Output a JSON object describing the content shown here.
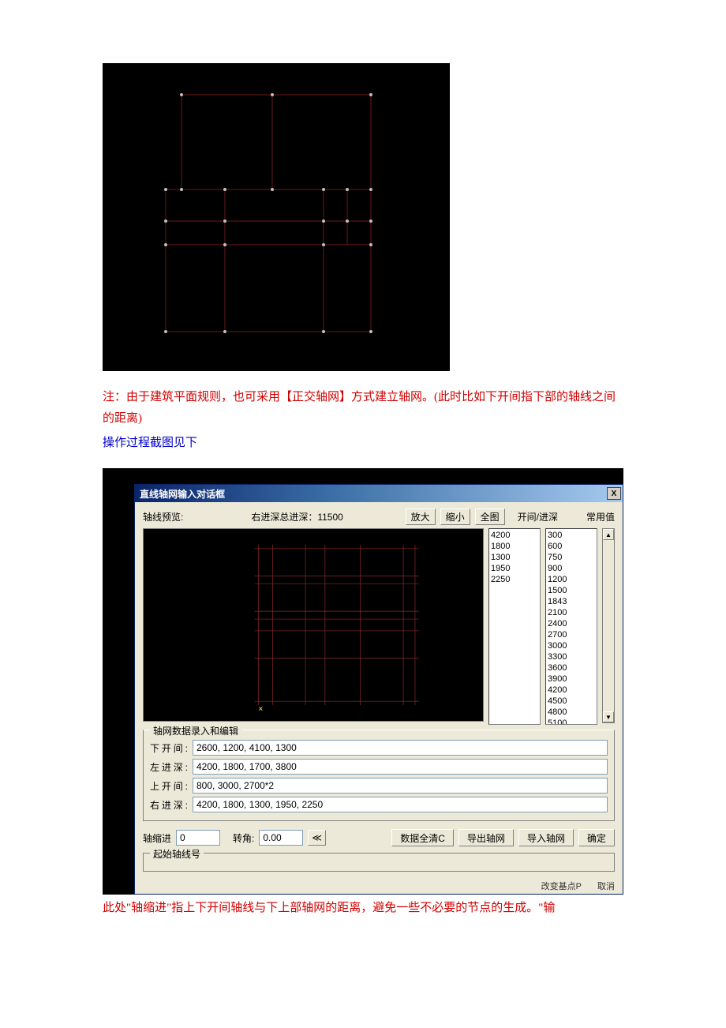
{
  "note1": "注：由于建筑平面规则，也可采用【正交轴网】方式建立轴网。(此时比如下开间指下部的轴线之间的距离)",
  "note2": "操作过程截图见下",
  "note3": "此处\"轴缩进\"指上下开间轴线与下上部轴网的距离，避免一些不必要的节点的生成。\"输",
  "dialog": {
    "title": "直线轴网输入对话框",
    "close": "X",
    "preview_label": "轴线预览:",
    "depth_summary": "右进深总进深：11500",
    "btn_zoomin": "放大",
    "btn_zoomout": "缩小",
    "btn_full": "全图",
    "col1_label": "开间/进深",
    "col2_label": "常用值",
    "list1": [
      "4200",
      "1800",
      "1300",
      "1950",
      "2250"
    ],
    "list2": [
      "300",
      "600",
      "750",
      "900",
      "1200",
      "1500",
      "1843",
      "2100",
      "2400",
      "2700",
      "3000",
      "3300",
      "3600",
      "3900",
      "4200",
      "4500",
      "4800",
      "5100"
    ],
    "grp1_title": "轴网数据录入和编辑",
    "fields": {
      "f1_label": "下开间:",
      "f1_value": "2600, 1200, 4100, 1300",
      "f2_label": "左进深:",
      "f2_value": "4200, 1800, 1700, 3800",
      "f3_label": "上开间:",
      "f3_value": "800, 3000, 2700*2",
      "f4_label": "右进深:",
      "f4_value": "4200, 1800, 1300, 1950, 2250"
    },
    "indent_label": "轴缩进",
    "indent_value": "0",
    "angle_label": "转角:",
    "angle_value": "0.00",
    "angle_btn": "≪",
    "btn_clear": "数据全清C",
    "btn_export": "导出轴网",
    "btn_import": "导入轴网",
    "btn_ok": "确定",
    "grp2_title": "起始轴线号",
    "bottom1": "改变基点P",
    "bottom2": "取消"
  }
}
